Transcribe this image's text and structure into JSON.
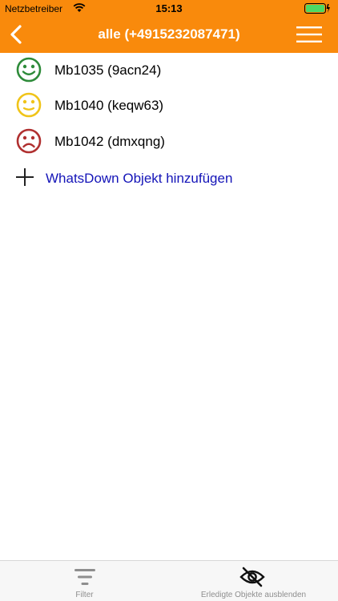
{
  "status_bar": {
    "carrier": "Netzbetreiber",
    "time": "15:13"
  },
  "nav": {
    "title": "alle (+4915232087471)"
  },
  "items": [
    {
      "label": "Mb1035 (9acn24)",
      "mood": "happy",
      "color": "#2e8b3a"
    },
    {
      "label": "Mb1040 (keqw63)",
      "mood": "neutral",
      "color": "#f0c419"
    },
    {
      "label": "Mb1042 (dmxqng)",
      "mood": "sad",
      "color": "#b03030"
    }
  ],
  "add_item": {
    "label": "WhatsDown Objekt hinzufügen"
  },
  "tab_bar": {
    "filter_label": "Filter",
    "hide_done_label": "Erledigte Objekte ausblenden"
  },
  "colors": {
    "header": "#f98a0c",
    "link": "#1414b8",
    "battery": "#4cd964"
  }
}
